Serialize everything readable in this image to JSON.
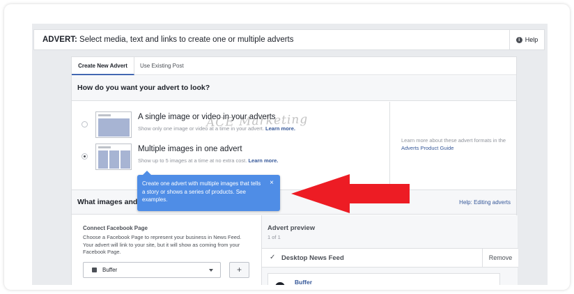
{
  "topbar": {
    "title_bold": "ADVERT:",
    "title_rest": " Select media, text and links to create one or multiple adverts",
    "help_label": "Help",
    "help_icon": "i"
  },
  "tabs": [
    {
      "label": "Create New Advert",
      "active": true
    },
    {
      "label": "Use Existing Post",
      "active": false
    }
  ],
  "section_title": "How do you want your advert to look?",
  "formats": [
    {
      "name": "A single image or video in your adverts",
      "desc": "Show only one image or video at a time in your advert.",
      "link": "Learn more.",
      "selected": false
    },
    {
      "name": "Multiple images in one advert",
      "desc": "Show up to 5 images at a time at no extra cost.",
      "link": "Learn more.",
      "selected": true
    }
  ],
  "aside": {
    "text": "Learn more about these advert formats in the ",
    "link": "Adverts Product Guide"
  },
  "watermark": "ACE Marketing",
  "tooltip": {
    "text": "Create one advert with multiple images that tells a story or shows a series of products. See examples.",
    "close": "×",
    "background": "#4f8de6"
  },
  "images_section": {
    "title": "What images and",
    "help_link": "Help: Editing adverts"
  },
  "connect": {
    "title": "Connect Facebook Page",
    "desc": "Choose a Facebook Page to represent your business in News Feed. Your advert will link to your site, but it will show as coming from your Facebook Page.",
    "select_value": "Buffer",
    "add_label": "+"
  },
  "preview": {
    "title": "Advert preview",
    "count": "1 of 1",
    "check": "✓",
    "feed_name": "Desktop News Feed",
    "remove_label": "Remove",
    "page_name": "Buffer"
  },
  "colors": {
    "arrow": "#ed1c24",
    "link": "#365899",
    "accent": "#4267b2"
  }
}
